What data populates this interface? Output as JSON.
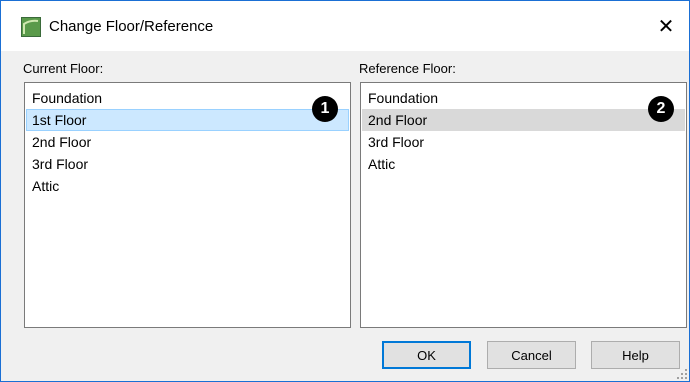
{
  "window": {
    "title": "Change Floor/Reference",
    "close_glyph": "✕"
  },
  "current_floor": {
    "label": "Current Floor:",
    "items": [
      "Foundation",
      "1st Floor",
      "2nd Floor",
      "3rd Floor",
      "Attic"
    ],
    "selected": "1st Floor",
    "badge": "1"
  },
  "reference_floor": {
    "label": "Reference Floor:",
    "items": [
      "Foundation",
      "2nd Floor",
      "3rd Floor",
      "Attic"
    ],
    "selected": "2nd Floor",
    "badge": "2"
  },
  "buttons": {
    "ok": "OK",
    "cancel": "Cancel",
    "help": "Help"
  },
  "colors": {
    "selection_blue": "#cce8ff",
    "selection_gray": "#d9d9d9",
    "default_button_border": "#0078d7"
  }
}
